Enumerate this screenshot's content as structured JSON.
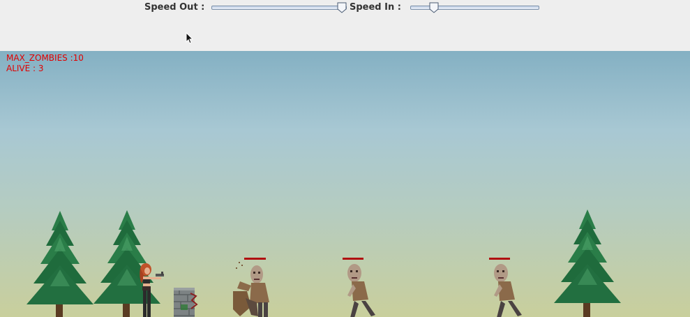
{
  "controls": {
    "speed_out_label": "Speed Out :",
    "speed_out_level": 1.0,
    "speed_in_label": "Speed In :",
    "speed_in_level": 0.16
  },
  "hud": {
    "max_zombies": "MAX_ZOMBIES :10",
    "alive": "ALIVE : 3"
  },
  "colors": {
    "hud_text": "#e00000",
    "sky_top": "#84b0c3",
    "ground_haze": "#c9cf9c",
    "tree_green": "#1f6b3c",
    "health_bar": "#b01010"
  },
  "scene": {
    "trees": [
      "pine-tree",
      "pine-tree",
      "pine-tree"
    ],
    "player": "red-haired-gunner",
    "obstacle": "stone-barrel",
    "zombies": [
      "zombie-attacking",
      "zombie-walking",
      "zombie-walking"
    ]
  }
}
